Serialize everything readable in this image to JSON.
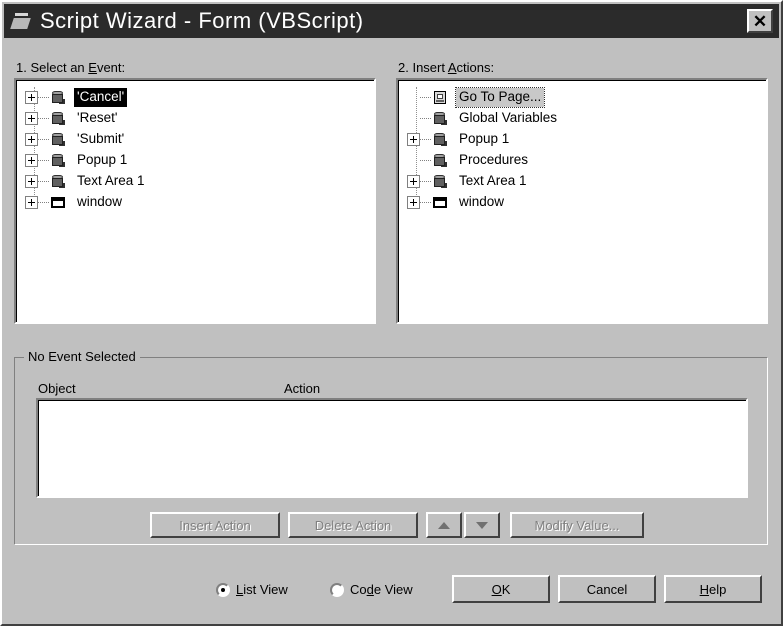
{
  "window": {
    "title": "Script Wizard - Form (VBScript)",
    "icon": "script-wizard-icon",
    "close_label": "✕"
  },
  "left_panel": {
    "label_prefix": "1. Select an ",
    "label_accel": "E",
    "label_suffix": "vent:",
    "full_label": "1. Select an Event:",
    "items": [
      {
        "label": "'Cancel'",
        "icon": "object-cube-icon",
        "expandable": true,
        "state": "selected"
      },
      {
        "label": "'Reset'",
        "icon": "object-cube-icon",
        "expandable": true,
        "state": "normal"
      },
      {
        "label": "'Submit'",
        "icon": "object-cube-icon",
        "expandable": true,
        "state": "normal"
      },
      {
        "label": "Popup 1",
        "icon": "object-cube-icon",
        "expandable": true,
        "state": "normal"
      },
      {
        "label": "Text Area 1",
        "icon": "object-cube-icon",
        "expandable": true,
        "state": "normal"
      },
      {
        "label": "window",
        "icon": "window-icon",
        "expandable": true,
        "state": "normal"
      }
    ]
  },
  "right_panel": {
    "label_prefix": "2. Insert ",
    "label_accel": "A",
    "label_suffix": "ctions:",
    "full_label": "2. Insert Actions:",
    "items": [
      {
        "label": "Go To Page...",
        "icon": "page-icon",
        "expandable": false,
        "state": "focused"
      },
      {
        "label": "Global Variables",
        "icon": "object-cube-icon",
        "expandable": false,
        "state": "normal"
      },
      {
        "label": "Popup 1",
        "icon": "object-cube-icon",
        "expandable": true,
        "state": "normal"
      },
      {
        "label": "Procedures",
        "icon": "object-cube-icon",
        "expandable": false,
        "state": "normal"
      },
      {
        "label": "Text Area 1",
        "icon": "object-cube-icon",
        "expandable": true,
        "state": "normal"
      },
      {
        "label": "window",
        "icon": "window-icon",
        "expandable": true,
        "state": "normal"
      }
    ]
  },
  "action_group": {
    "legend": "No Event Selected",
    "columns": {
      "object": "Object",
      "action": "Action"
    },
    "rows": []
  },
  "action_buttons": {
    "insert_action": "Insert Action",
    "delete_action": "Delete Action",
    "move_up": "▲",
    "move_down": "▼",
    "modify_value": "Modify Value..."
  },
  "view_mode": {
    "list_view": {
      "prefix": "L",
      "accel": "",
      "text_before": "L",
      "label": "List View",
      "checked": true
    },
    "code_view": {
      "label": "Code View",
      "checked": false
    }
  },
  "dialog_buttons": {
    "ok_before": "O",
    "ok_accel": "O",
    "ok": "OK",
    "cancel": "Cancel",
    "help": "Help"
  },
  "colors": {
    "face": "#c0c0c0",
    "titlebar": "#2b2b2b",
    "selection": "#000000",
    "window_bg": "#ffffff",
    "disabled_text": "#808080"
  }
}
